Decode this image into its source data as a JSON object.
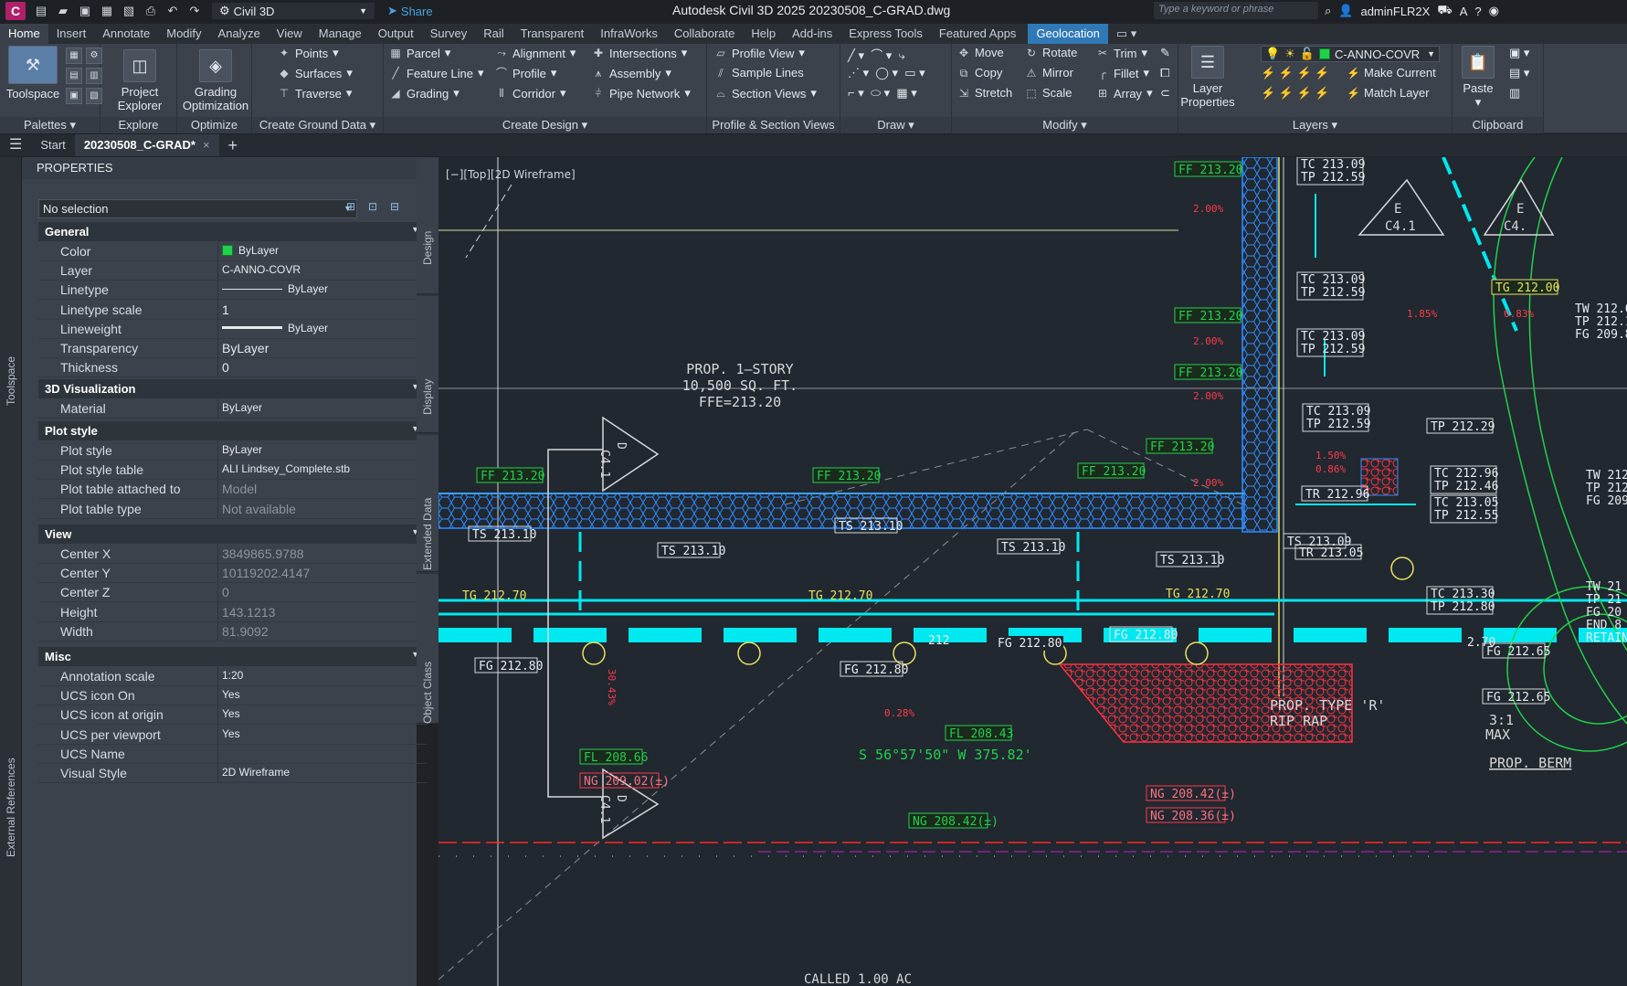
{
  "titlebar": {
    "app_logo": "C",
    "workspace": "Civil 3D",
    "share": "Share",
    "title": "Autodesk Civil 3D 2025   20230508_C-GRAD.dwg",
    "search_placeholder": "Type a keyword or phrase",
    "user": "adminFLR2X"
  },
  "tabs": [
    "Home",
    "Insert",
    "Annotate",
    "Modify",
    "Analyze",
    "View",
    "Manage",
    "Output",
    "Survey",
    "Rail",
    "Transparent",
    "InfraWorks",
    "Collaborate",
    "Help",
    "Add-ins",
    "Express Tools",
    "Featured Apps"
  ],
  "tab_geolocation": "Geolocation",
  "ribbon": {
    "palettes": {
      "title": "Palettes",
      "toolspace": "Toolspace"
    },
    "explore": {
      "title": "Explore",
      "project_explorer": "Project Explorer"
    },
    "optimize": {
      "title": "Optimize",
      "grading_optimization": "Grading Optimization"
    },
    "ground_data": {
      "title": "Create Ground Data",
      "points": "Points",
      "surfaces": "Surfaces",
      "traverse": "Traverse"
    },
    "design": {
      "title": "Create Design",
      "parcel": "Parcel",
      "feature_line": "Feature Line",
      "grading": "Grading",
      "alignment": "Alignment",
      "profile": "Profile",
      "corridor": "Corridor",
      "intersections": "Intersections",
      "assembly": "Assembly",
      "pipe_network": "Pipe Network"
    },
    "profile_section": {
      "title": "Profile & Section Views",
      "profile_view": "Profile View",
      "sample_lines": "Sample Lines",
      "section_views": "Section Views"
    },
    "draw": {
      "title": "Draw"
    },
    "modify": {
      "title": "Modify",
      "move": "Move",
      "copy": "Copy",
      "stretch": "Stretch",
      "rotate": "Rotate",
      "mirror": "Mirror",
      "scale": "Scale",
      "trim": "Trim",
      "fillet": "Fillet",
      "array": "Array"
    },
    "layers": {
      "title": "Layers",
      "layer_properties": "Layer Properties",
      "current_layer": "C-ANNO-COVR",
      "make_current": "Make Current",
      "match_layer": "Match Layer"
    },
    "clipboard": {
      "title": "Clipboard",
      "paste": "Paste"
    }
  },
  "doctabs": {
    "start": "Start",
    "file": "20230508_C-GRAD*",
    "close": "×",
    "add": "+"
  },
  "properties": {
    "header": "PROPERTIES",
    "selection": "No selection",
    "sections": {
      "general": "General",
      "visualization": "3D Visualization",
      "plot_style": "Plot style",
      "view": "View",
      "misc": "Misc"
    },
    "general": [
      {
        "k": "Color",
        "v": "ByLayer"
      },
      {
        "k": "Layer",
        "v": "C-ANNO-COVR"
      },
      {
        "k": "Linetype",
        "v": "ByLayer"
      },
      {
        "k": "Linetype scale",
        "v": "1"
      },
      {
        "k": "Lineweight",
        "v": "ByLayer"
      },
      {
        "k": "Transparency",
        "v": "ByLayer"
      },
      {
        "k": "Thickness",
        "v": "0"
      }
    ],
    "visualization": [
      {
        "k": "Material",
        "v": "ByLayer"
      }
    ],
    "plot_style": [
      {
        "k": "Plot style",
        "v": "ByLayer"
      },
      {
        "k": "Plot style table",
        "v": "ALI Lindsey_Complete.stb"
      },
      {
        "k": "Plot table attached to",
        "v": "Model"
      },
      {
        "k": "Plot table type",
        "v": "Not available"
      }
    ],
    "view": [
      {
        "k": "Center X",
        "v": "3849865.9788"
      },
      {
        "k": "Center Y",
        "v": "10119202.4147"
      },
      {
        "k": "Center Z",
        "v": "0"
      },
      {
        "k": "Height",
        "v": "143.1213"
      },
      {
        "k": "Width",
        "v": "81.9092"
      }
    ],
    "misc": [
      {
        "k": "Annotation scale",
        "v": "1:20"
      },
      {
        "k": "UCS icon On",
        "v": "Yes"
      },
      {
        "k": "UCS icon at origin",
        "v": "Yes"
      },
      {
        "k": "UCS per viewport",
        "v": "Yes"
      },
      {
        "k": "UCS Name",
        "v": ""
      },
      {
        "k": "Visual Style",
        "v": "2D Wireframe"
      }
    ]
  },
  "side_tabs": {
    "toolspace": "Toolspace",
    "external_refs": "External References",
    "design": "Design",
    "display": "Display",
    "extended_data": "Extended Data",
    "object_class": "Object Class"
  },
  "drawing": {
    "viewport_label": "[−][Top][2D Wireframe]",
    "building": [
      "PROP. 1–STORY",
      "10,500 SQ. FT.",
      "FFE=213.20"
    ],
    "riprap": [
      "PROP. TYPE 'R'",
      "RIP RAP"
    ],
    "bearing": "S 56°57'50\"  W   375.82'",
    "berm": "PROP. BERM",
    "slope": [
      "3:1",
      "MAX"
    ],
    "called": "CALLED 1.00 AC",
    "ff_labels": [
      "FF 213.20",
      "FF 213.20",
      "FF 213.20",
      "FF 213.20",
      "FF 213.20",
      "FF 213.20",
      "FF 213.20",
      "FF 213.20"
    ],
    "tg_labels": [
      "TG 212.70",
      "TG 212.70",
      "TG 212.70",
      "TG 212.00"
    ],
    "fg_labels": [
      "FG 212.80",
      "FG 212.80",
      "FG 212.80",
      "FG 212.65",
      "FG 212.65"
    ],
    "ts_labels": [
      "TS 213.10",
      "TS 213.10",
      "TS 213.10",
      "TS 213.10",
      "TS 213.10",
      "TS 213.09"
    ],
    "tc_tp": [
      [
        "TC 213.09",
        "TP 212.59"
      ],
      [
        "TC 213.09",
        "TP 212.59"
      ],
      [
        "TC 213.09",
        "TP 212.59"
      ],
      [
        "TC 213.09",
        "TP 212.59"
      ],
      [
        "TC 212.96",
        "TP 212.46"
      ],
      [
        "TC 213.05",
        "TP 212.55"
      ],
      [
        "TC 213.30",
        "TP 212.80"
      ]
    ],
    "tp_single": "TP 212.29",
    "tr_labels": [
      "TR 212.96",
      "TR 213.05"
    ],
    "fl": "FL 208.66",
    "fl2": "FL 208.43",
    "ng_labels": [
      "NG 209.02(±)",
      "NG 208.42(±)",
      "NG 208.42(±)",
      "NG 208.36(±)"
    ],
    "section_marks": [
      {
        "l": "D",
        "s": "C4.1"
      },
      {
        "l": "D",
        "s": "C4.1"
      },
      {
        "l": "E",
        "s": "C4.1"
      },
      {
        "l": "E",
        "s": "C4."
      }
    ],
    "slopes": [
      "2.00%",
      "1.50%",
      "0.86%",
      "0.28%",
      "0.83%",
      "1.85%",
      "30.43%"
    ],
    "right_edge": [
      [
        "TW 212.6",
        "TP 212.1",
        "FG 209.8"
      ],
      [
        "TW 212",
        "TP 212",
        "FG 209"
      ],
      [
        "TW 21",
        "TP 21",
        "FG 20",
        "END 8",
        "RETAIN"
      ]
    ],
    "clip": [
      "FG 212.80",
      "2.70",
      "212"
    ]
  }
}
